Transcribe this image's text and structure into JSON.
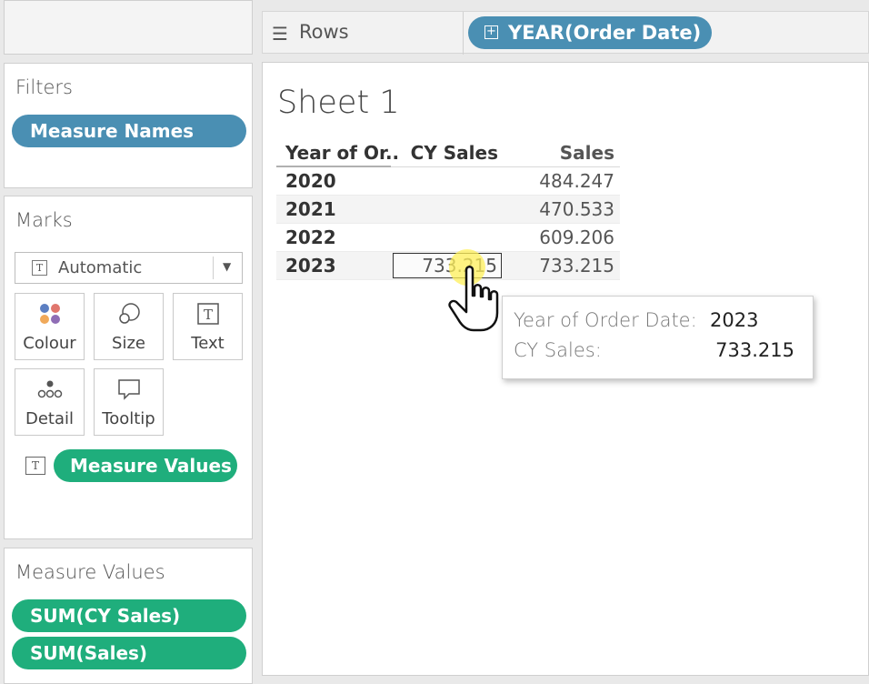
{
  "rows_shelf": {
    "label": "Rows",
    "pill": "YEAR(Order Date)"
  },
  "filters": {
    "title": "Filters",
    "pills": [
      "Measure Names"
    ]
  },
  "marks": {
    "title": "Marks",
    "type": "Automatic",
    "buttons": [
      {
        "label": "Colour",
        "icon": "colour-icon"
      },
      {
        "label": "Size",
        "icon": "size-icon"
      },
      {
        "label": "Text",
        "icon": "text-icon"
      },
      {
        "label": "Detail",
        "icon": "detail-icon"
      },
      {
        "label": "Tooltip",
        "icon": "tooltip-icon"
      }
    ],
    "field_pill": "Measure Values"
  },
  "measure_values_card": {
    "title": "Measure Values",
    "pills": [
      "SUM(CY Sales)",
      "SUM(Sales)"
    ]
  },
  "sheet": {
    "title": "Sheet 1",
    "columns": [
      "Year of Or..",
      "CY Sales",
      "Sales"
    ],
    "rows": [
      {
        "year": "2020",
        "cy_sales": "",
        "sales": "484.247"
      },
      {
        "year": "2021",
        "cy_sales": "",
        "sales": "470.533"
      },
      {
        "year": "2022",
        "cy_sales": "",
        "sales": "609.206"
      },
      {
        "year": "2023",
        "cy_sales": "733.215",
        "sales": "733.215"
      }
    ]
  },
  "tooltip": {
    "line1_key": "Year of Order Date:",
    "line1_val": "2023",
    "line2_key": "CY Sales:",
    "line2_val": "733.215"
  },
  "colors": {
    "pill_blue": "#4a8fb3",
    "pill_green": "#1fae7c"
  }
}
